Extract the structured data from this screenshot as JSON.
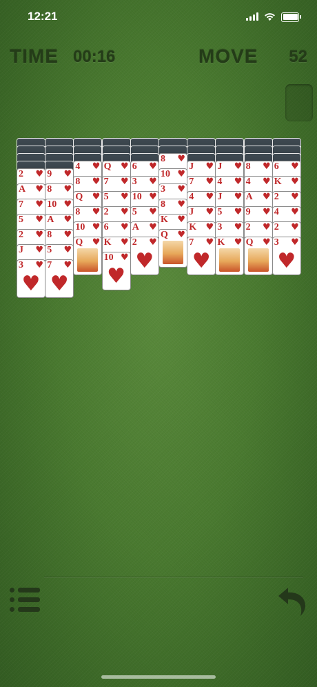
{
  "status_bar": {
    "time": "12:21"
  },
  "hud": {
    "time_label": "TIME",
    "time_value": "00:16",
    "move_label": "MOVE",
    "move_value": "52"
  },
  "colors": {
    "felt": "#4a7a30",
    "hud_text": "#243c18",
    "card_red": "#c0282a",
    "card_back": "#2b343a"
  },
  "tableau": [
    {
      "face_down": 4,
      "face_up": [
        "2",
        "A",
        "7",
        "5",
        "2",
        "J",
        "3"
      ]
    },
    {
      "face_down": 4,
      "face_up": [
        "9",
        "8",
        "10",
        "A",
        "8",
        "5",
        "7"
      ]
    },
    {
      "face_down": 3,
      "face_up": [
        "4",
        "8",
        "Q",
        "8",
        "10",
        "Q"
      ]
    },
    {
      "face_down": 3,
      "face_up": [
        "Q",
        "7",
        "5",
        "2",
        "6",
        "K",
        "10"
      ]
    },
    {
      "face_down": 3,
      "face_up": [
        "6",
        "3",
        "10",
        "5",
        "A",
        "2"
      ]
    },
    {
      "face_down": 2,
      "face_up": [
        "8",
        "10",
        "3",
        "8",
        "K",
        "Q"
      ]
    },
    {
      "face_down": 3,
      "face_up": [
        "J",
        "7",
        "4",
        "J",
        "K",
        "7"
      ]
    },
    {
      "face_down": 3,
      "face_up": [
        "J",
        "4",
        "J",
        "5",
        "3",
        "K"
      ]
    },
    {
      "face_down": 3,
      "face_up": [
        "8",
        "4",
        "A",
        "9",
        "2",
        "Q"
      ]
    },
    {
      "face_down": 3,
      "face_up": [
        "6",
        "K",
        "2",
        "4",
        "2",
        "3"
      ]
    }
  ],
  "suit_symbol": "♥",
  "icons": {
    "wifi": "wifi-icon",
    "battery": "battery-icon",
    "menu": "menu-list-icon",
    "undo": "undo-icon"
  }
}
